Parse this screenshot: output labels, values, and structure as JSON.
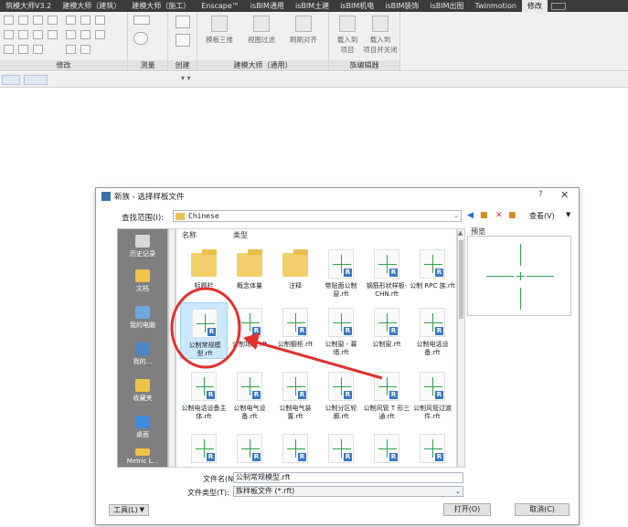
{
  "ribbon": {
    "tabs": [
      "筑模大师V3.2",
      "建模大师（建筑）",
      "建模大师（施工）",
      "Enscape™",
      "isBIM通用",
      "isBIM土建",
      "isBIM机电",
      "isBIM装饰",
      "isBIM出图",
      "Twinmotion",
      "修改"
    ],
    "active_tab": "修改",
    "panels": {
      "modify": "修改",
      "measure": "测量",
      "create": "创建",
      "builder": "建模大师（通用）",
      "family_editor": "族编辑器"
    },
    "buttons": {
      "model_3d": "模板三维",
      "model_filter": "视图过滤",
      "sweep_align": "刷刷对齐",
      "load_project": "载入到\n项目",
      "load_close": "载入到\n项目并关闭"
    }
  },
  "dialog": {
    "title": "新族 - 选择样板文件",
    "help": "?",
    "close": "✕",
    "look_in_label": "查找范围(I):",
    "look_in_value": "Chinese",
    "view_menu": "查看(V)",
    "preview_label": "预览",
    "columns": {
      "name": "名称",
      "type": "类型"
    },
    "places": [
      "历史记录",
      "文档",
      "我的电脑",
      "我的...",
      "收藏夹",
      "桌面",
      "Metric L..."
    ],
    "files": [
      {
        "name": "标题栏",
        "kind": "folder"
      },
      {
        "name": "概念体量",
        "kind": "folder"
      },
      {
        "name": "注释",
        "kind": "folder"
      },
      {
        "name": "带贴面公制窗.rft",
        "kind": "rft"
      },
      {
        "name": "钢筋形状样板-CHN.rft",
        "kind": "rft"
      },
      {
        "name": "公制 RPC 族.rft",
        "kind": "rft"
      },
      {
        "name": "公制常规模型.rft",
        "kind": "rft",
        "selected": true
      },
      {
        "name": "公制场地.rft",
        "kind": "rft"
      },
      {
        "name": "公制橱柜.rft",
        "kind": "rft"
      },
      {
        "name": "公制窗 - 幕墙.rft",
        "kind": "rft"
      },
      {
        "name": "公制窗.rft",
        "kind": "rft"
      },
      {
        "name": "公制电话设备.rft",
        "kind": "rft"
      },
      {
        "name": "公制电话设备主体.rft",
        "kind": "rft"
      },
      {
        "name": "公制电气设备.rft",
        "kind": "rft"
      },
      {
        "name": "公制电气装置.rft",
        "kind": "rft"
      },
      {
        "name": "公制分区轮廓.rft",
        "kind": "rft"
      },
      {
        "name": "公制风管 T 形三通.rft",
        "kind": "rft"
      },
      {
        "name": "公制风管过渡件.rft",
        "kind": "rft"
      }
    ],
    "file_name_label": "文件名(N):",
    "file_name_value": "公制常规模型.rft",
    "file_type_label": "文件类型(T):",
    "file_type_value": "族样板文件 (*.rft)",
    "tools_label": "工具(L)",
    "open_label": "打开(O)",
    "cancel_label": "取消(C)"
  },
  "colors": {
    "highlight_red": "#e0312f",
    "selection": "#cce8ff",
    "template_green": "#2fa34a",
    "revit_badge": "#3b78c4"
  }
}
